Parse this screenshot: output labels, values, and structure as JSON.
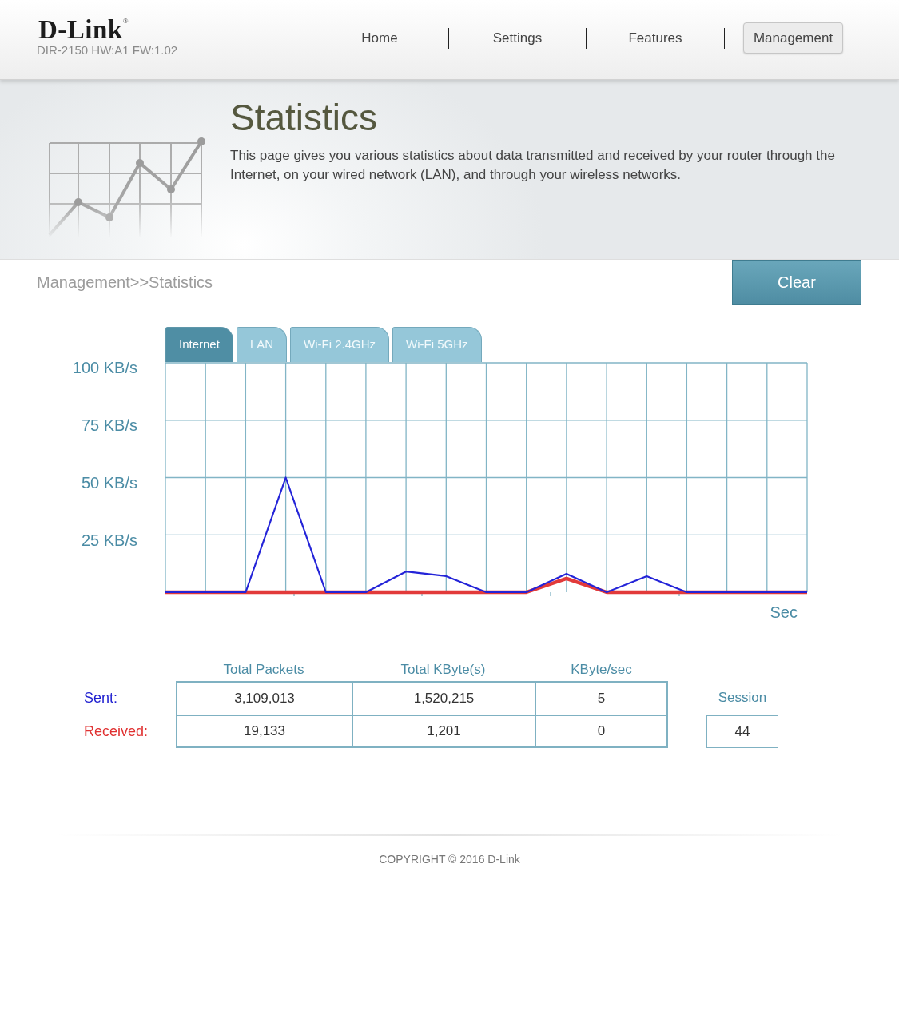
{
  "header": {
    "logo": "D-Link$^{®}$",
    "model_info": "DIR-2150 HW:A1 FW:1.02",
    "nav": [
      {
        "label": "Home",
        "selected": false
      },
      {
        "label": "Settings",
        "selected": false
      },
      {
        "label": "Features",
        "selected": false
      },
      {
        "label": "Management",
        "selected": true
      }
    ]
  },
  "banner": {
    "title": "Statistics",
    "description": "This page gives you various statistics about data transmitted and received by your router through the Internet, on your wired network (LAN), and through your wireless networks."
  },
  "toolbar": {
    "breadcrumb": "Management>>Statistics",
    "clear_button": "Clear"
  },
  "chart_tabs": [
    {
      "label": "Internet",
      "selected": true
    },
    {
      "label": "LAN",
      "selected": false
    },
    {
      "label": "Wi-Fi 2.4GHz",
      "selected": false
    },
    {
      "label": "Wi-Fi 5GHz",
      "selected": false
    }
  ],
  "chart": {
    "chart_data": {
      "type": "line",
      "grid": true,
      "xlabel": "Sec",
      "ylim": [
        0,
        100
      ],
      "yticks": [
        {
          "value": 25,
          "label": "25 KB/s"
        },
        {
          "value": 50,
          "label": "50 KB/s"
        },
        {
          "value": 75,
          "label": "75 KB/s"
        },
        {
          "value": 100,
          "label": "100 KB/s"
        }
      ],
      "series": [
        {
          "color": "#2424d8",
          "values": [
            0,
            0,
            0,
            50,
            0,
            0,
            9,
            7,
            0,
            0,
            8,
            0,
            7,
            0,
            0,
            0,
            0
          ]
        },
        {
          "color": "#e23a3a",
          "values": [
            0,
            0,
            0,
            0,
            0,
            0,
            0,
            0,
            0,
            0,
            6,
            0,
            0,
            0,
            0,
            0,
            0
          ]
        }
      ]
    }
  },
  "table": {
    "columns": [
      "Total Packets",
      "Total KByte(s)",
      "KByte/sec"
    ],
    "rows": [
      {
        "label": "Sent:",
        "color": "#1f1fd0",
        "cells": [
          "3,109,013",
          "1,520,215",
          "5"
        ]
      },
      {
        "label": "Received:",
        "color": "#e03232",
        "cells": [
          "19,133",
          "1,201",
          "0"
        ]
      }
    ]
  },
  "session": {
    "label": "Session",
    "value": "44"
  },
  "footer": {
    "copyright": "COPYRIGHT © 2016 D-Link"
  }
}
